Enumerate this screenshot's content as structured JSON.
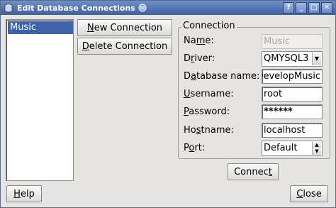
{
  "window": {
    "title": "Edit Database Connections",
    "controls": {
      "help": "?",
      "minimize": "_",
      "maximize": "□",
      "close": "✕"
    }
  },
  "connections_list": {
    "items": [
      "Music"
    ],
    "selected_index": 0
  },
  "buttons": {
    "new_connection": {
      "mnemonic": "N",
      "rest": "ew Connection"
    },
    "delete_connection": {
      "mnemonic": "D",
      "rest": "elete Connection"
    },
    "connect": {
      "pre": "Connec",
      "mnemonic": "t",
      "post": ""
    },
    "help": {
      "mnemonic": "H",
      "rest": "elp"
    },
    "close": {
      "mnemonic": "C",
      "rest": "lose"
    }
  },
  "connection_group": {
    "title": "Connection",
    "fields": {
      "name": {
        "label_pre": "Na",
        "label_mnemonic": "m",
        "label_post": "e:",
        "value": "Music"
      },
      "driver": {
        "label_pre": "D",
        "label_mnemonic": "r",
        "label_post": "iver:",
        "value": "QMYSQL3"
      },
      "database_name": {
        "label_pre": "D",
        "label_mnemonic": "a",
        "label_post": "tabase name:",
        "value": "DevelopMusic"
      },
      "username": {
        "label_pre": "",
        "label_mnemonic": "U",
        "label_post": "sername:",
        "value": "root"
      },
      "password": {
        "label_pre": "",
        "label_mnemonic": "P",
        "label_post": "assword:",
        "value": "******"
      },
      "hostname": {
        "label_pre": "Ho",
        "label_mnemonic": "s",
        "label_post": "tname:",
        "value": "localhost"
      },
      "port": {
        "label_pre": "P",
        "label_mnemonic": "o",
        "label_post": "rt:",
        "value": "Default"
      }
    }
  },
  "colors": {
    "titlebar": "#3f5f9e",
    "selection": "#3f63a8",
    "dialog_bg": "#e6e4e0"
  },
  "icons": {
    "title_app": "database-icon",
    "title_menu": "menu-stack-icon",
    "combo_arrow": "chevron-down-icon",
    "spin_up": "arrow-up-icon",
    "spin_down": "arrow-down-icon"
  }
}
